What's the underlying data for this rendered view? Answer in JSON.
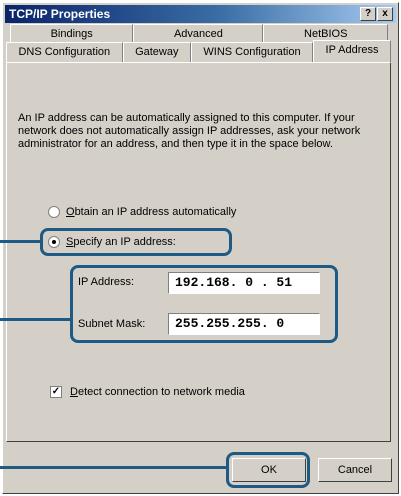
{
  "window": {
    "title": "TCP/IP Properties",
    "help_button": "?",
    "close_button": "x"
  },
  "tabs": {
    "back_row": [
      "Bindings",
      "Advanced",
      "NetBIOS"
    ],
    "front_row": [
      "DNS Configuration",
      "Gateway",
      "WINS Configuration",
      "IP Address"
    ],
    "active": "IP Address"
  },
  "description": "An IP address can be automatically assigned to this computer. If your network does not automatically assign IP addresses, ask your network administrator for an address, and then type it in the space below.",
  "radios": {
    "obtain": {
      "label_first": "O",
      "label_rest": "btain an IP address automatically",
      "checked": false
    },
    "specify": {
      "label_first": "S",
      "label_rest": "pecify an IP address:",
      "checked": true
    }
  },
  "fields": {
    "ip_address": {
      "label": "IP Address:",
      "value": "192.168. 0 . 51"
    },
    "subnet_mask": {
      "label": "Subnet Mask:",
      "value": "255.255.255. 0"
    }
  },
  "checkbox": {
    "label_first": "D",
    "label_rest": "etect connection to network media",
    "checked": true,
    "check_glyph": "✓"
  },
  "buttons": {
    "ok": "OK",
    "cancel": "Cancel"
  },
  "colors": {
    "callout": "#1f5a85",
    "title_bar_start": "#0a246a",
    "dialog_face": "#d4d0c8"
  }
}
